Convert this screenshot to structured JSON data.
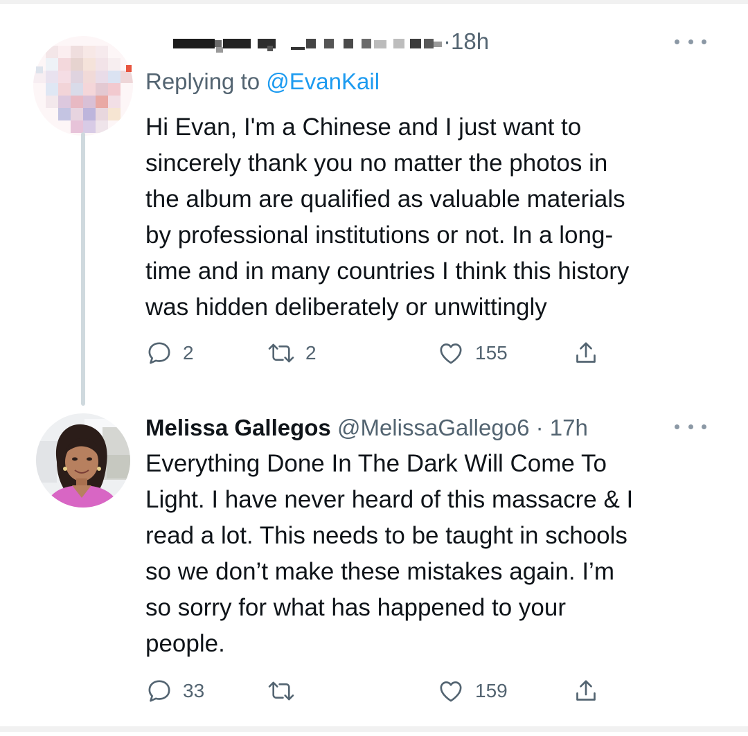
{
  "tweets": [
    {
      "display_name": "",
      "handle": "",
      "time": "18h",
      "replying_prefix": "Replying to",
      "replying_to": "@EvanKail",
      "text": "Hi Evan, I'm a Chinese and I just want to\nsincerely thank you no matter the photos in\nthe album are qualified as valuable materials\nby professional institutions or not. In a long-\ntime and in many countries I think this history\nwas hidden deliberately or unwittingly",
      "reply_count": "2",
      "retweet_count": "2",
      "like_count": "155",
      "avatar_icon": "pixelated-avatar"
    },
    {
      "display_name": "Melissa Gallegos",
      "handle": "@MelissaGallego6",
      "time": "17h",
      "text": "Everything Done In The Dark Will Come To\nLight. I have never heard of this massacre & I\nread a lot. This needs to be taught in schools\nso we don’t make these mistakes again. I’m\nso sorry for what has happened to your\npeople.",
      "reply_count": "33",
      "retweet_count": "",
      "like_count": "159",
      "avatar_icon": "profile-photo"
    }
  ],
  "icons": {
    "reply": "speech-bubble-icon",
    "retweet": "retweet-arrows-icon",
    "like": "heart-icon",
    "share": "share-upload-icon",
    "more": "more-horizontal-icon"
  },
  "colors": {
    "text": "#0f1419",
    "secondary": "#536471",
    "link": "#1d9bf0",
    "thread_line": "#cfd9de"
  }
}
